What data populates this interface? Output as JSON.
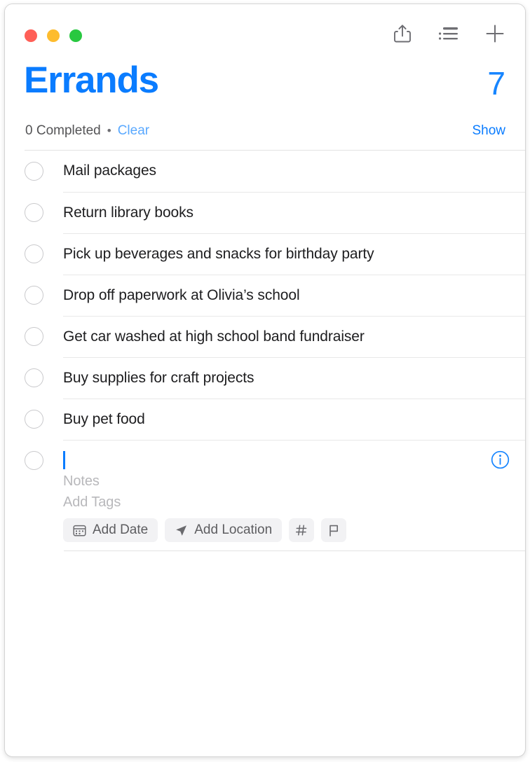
{
  "window": {
    "traffic_lights": [
      {
        "name": "close",
        "color": "#ff5f57"
      },
      {
        "name": "minimize",
        "color": "#febc2e"
      },
      {
        "name": "zoom",
        "color": "#28c840"
      }
    ]
  },
  "toolbar": {
    "items": [
      {
        "icon": "share-icon",
        "label": "Share"
      },
      {
        "icon": "list-view-icon",
        "label": "List View"
      },
      {
        "icon": "plus-icon",
        "label": "Add Reminder"
      }
    ]
  },
  "header": {
    "title": "Errands",
    "count": "7",
    "title_color": "#0a7cff",
    "count_color": "#1785ff"
  },
  "completed_bar": {
    "completed_label": "0 Completed",
    "separator": "•",
    "clear_label": "Clear",
    "show_label": "Show",
    "link_color": "#0a7cff"
  },
  "tasks": [
    {
      "title": "Mail packages",
      "completed": false
    },
    {
      "title": "Return library books",
      "completed": false
    },
    {
      "title": "Pick up beverages and snacks for birthday party",
      "completed": false
    },
    {
      "title": "Drop off paperwork at Olivia’s school",
      "completed": false
    },
    {
      "title": "Get car washed at high school band fundraiser",
      "completed": false
    },
    {
      "title": "Buy supplies for craft projects",
      "completed": false
    },
    {
      "title": "Buy pet food",
      "completed": false
    }
  ],
  "new_task": {
    "value": "",
    "notes_placeholder": "Notes",
    "tags_placeholder": "Add Tags",
    "info_icon": "info-circle-icon",
    "chips": [
      {
        "icon": "calendar-icon",
        "label": "Add Date"
      },
      {
        "icon": "location-arrow-icon",
        "label": "Add Location"
      },
      {
        "icon": "hashtag-icon",
        "label": "#"
      },
      {
        "icon": "flag-icon",
        "label": ""
      }
    ]
  }
}
